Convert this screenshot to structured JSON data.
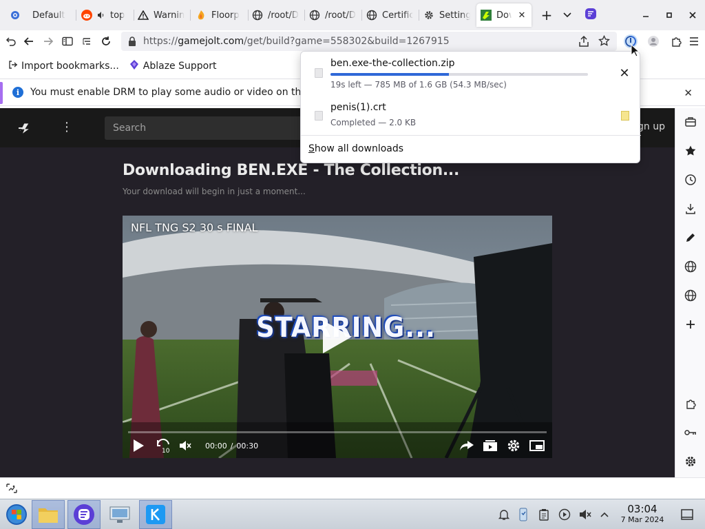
{
  "browser": {
    "tabs": [
      {
        "label": "Default",
        "icon": "globe-icon"
      },
      {
        "label": "top",
        "icon": "reddit-icon"
      },
      {
        "label": "Warning",
        "icon": "warning-icon"
      },
      {
        "label": "Floorp",
        "icon": "floorp-icon"
      },
      {
        "label": "/root/D",
        "icon": "globe-icon"
      },
      {
        "label": "/root/D",
        "icon": "globe-icon"
      },
      {
        "label": "Certific",
        "icon": "globe-icon"
      },
      {
        "label": "Setting",
        "icon": "gear-icon"
      },
      {
        "label": "Dow",
        "icon": "gamejolt-icon",
        "active": true
      }
    ],
    "url_prefix": "https://",
    "url_host": "gamejolt.com",
    "url_path": "/get/build?game=558302&build=1267915",
    "bookmarks": [
      {
        "label": "Import bookmarks...",
        "icon": "import-icon"
      },
      {
        "label": "Ablaze Support",
        "icon": "floorp-icon"
      }
    ],
    "drm_notice": "You must enable DRM to play some audio or video on this page."
  },
  "site": {
    "search_placeholder": "Search",
    "signup_label": "Sign up",
    "download_title": "Downloading BEN.EXE - The Collection...",
    "download_subtitle": "Your download will begin in just a moment..."
  },
  "video": {
    "title": "NFL TNG S2 30 s FINAL",
    "overlay_text": "STARRING...",
    "current_time": "00:00",
    "separator": "/",
    "duration": "00:30",
    "progress_fraction": 0.0,
    "skip_back_label": "10"
  },
  "downloads": {
    "items": [
      {
        "name": "ben.exe-the-collection.zip",
        "status": "19s left — 785 MB of 1.6 GB (54.3 MB/sec)",
        "progress_fraction": 0.46
      },
      {
        "name": "penis(1).crt",
        "status": "Completed — 2.0 KB"
      }
    ],
    "show_all_label": "Show all downloads"
  },
  "taskbar": {
    "time": "03:04",
    "date": "7 Mar 2024"
  },
  "colors": {
    "accent": "#2f68d8",
    "page_bg": "#232028",
    "site_header": "#191919",
    "drm_bar_accent": "#a66ef0"
  }
}
